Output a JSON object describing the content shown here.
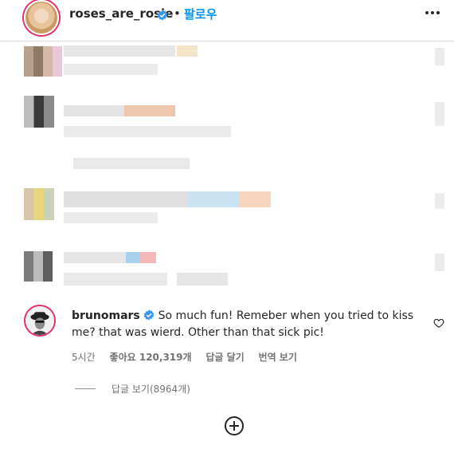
{
  "post_header": {
    "username": "roses_are_rosie",
    "separator": "•",
    "follow_label": "팔로우",
    "verified_icon": "verified-badge-icon",
    "more_icon": "more-dots-icon"
  },
  "colors": {
    "accent": "#0095f6",
    "verified": "#3897f0",
    "text": "#262626",
    "secondary": "#737373"
  },
  "comment": {
    "username": "brunomars",
    "text": "So much fun! Remeber when you tried to kiss me? that was wierd. Other than that sick pic!",
    "time": "5시간",
    "likes": "좋아요 120,319개",
    "reply_label": "답글 달기",
    "translate_label": "번역 보기",
    "like_icon": "heart-outline-icon"
  },
  "replies": {
    "view_label": "답글 보기(8964개)"
  },
  "load_more_icon": "plus-circle-icon"
}
